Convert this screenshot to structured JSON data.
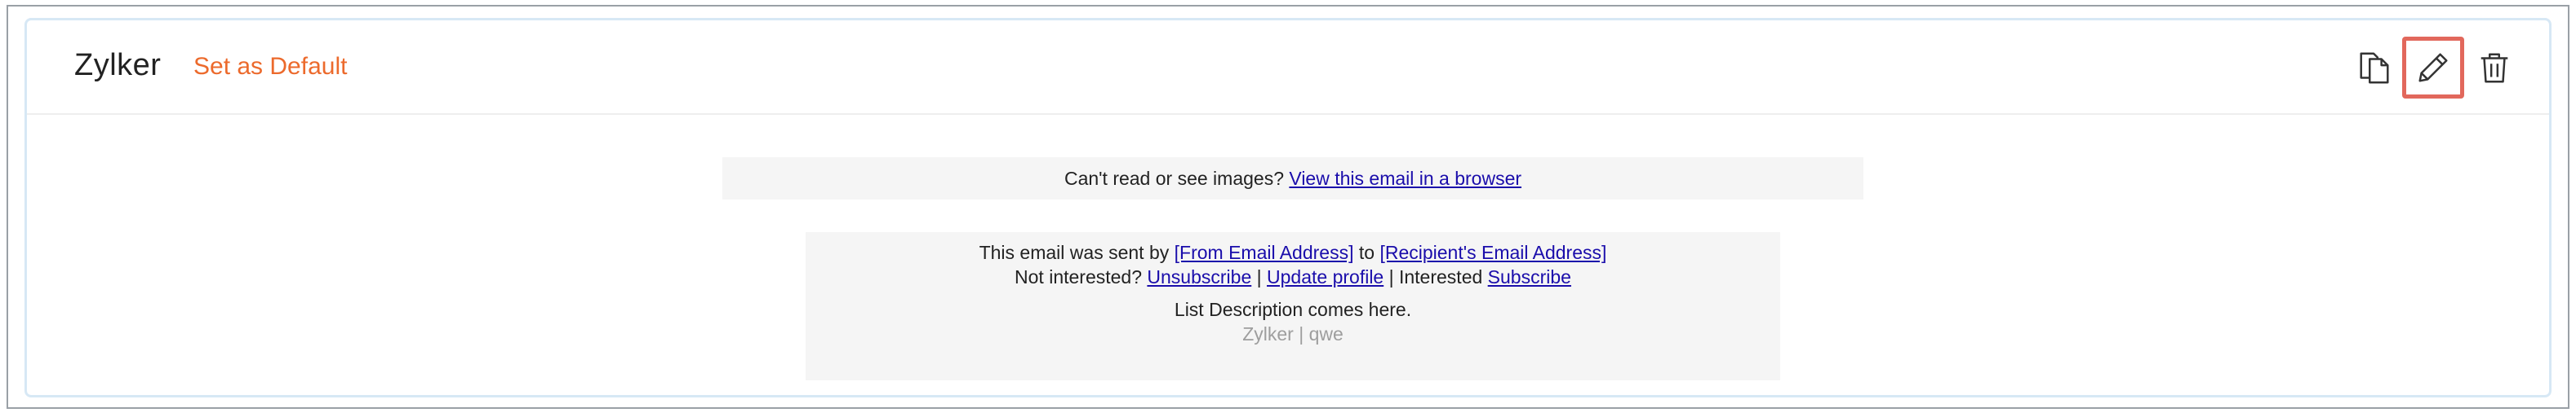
{
  "header": {
    "title": "Zylker",
    "set_default_label": "Set as Default",
    "actions": {
      "copy_icon": "copy-icon",
      "edit_icon": "pencil-icon",
      "delete_icon": "trash-icon"
    }
  },
  "preview": {
    "view_bar": {
      "text": "Can't read or see images?",
      "link": "View this email in a browser"
    },
    "footer": {
      "sent_by_text": "This email was sent by",
      "from_link": "[From Email Address]",
      "to_text": "to",
      "recipient_link": "[Recipient's Email Address]",
      "not_interested_text": "Not interested?",
      "unsubscribe_link": "Unsubscribe",
      "separator": "|",
      "update_profile_link": "Update profile",
      "interested_text": "Interested",
      "subscribe_link": "Subscribe",
      "list_description": "List Description comes here.",
      "org_line": "Zylker | qwe"
    }
  },
  "colors": {
    "accent": "#ec6a2c",
    "link": "#1a0dab",
    "highlight": "#e2685c",
    "card_border": "#d7e8f5",
    "preview_bg": "#f5f5f5"
  }
}
